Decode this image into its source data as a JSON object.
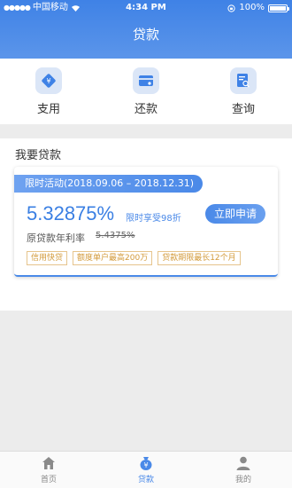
{
  "status": {
    "carrier": "中国移动",
    "time": "4:34 PM",
    "battery": "100%"
  },
  "header": {
    "title": "贷款"
  },
  "quick_actions": [
    {
      "label": "支用",
      "icon": "withdraw-icon"
    },
    {
      "label": "还款",
      "icon": "card-icon"
    },
    {
      "label": "查询",
      "icon": "search-doc-icon"
    }
  ],
  "section": {
    "title": "我要贷款"
  },
  "loan_card": {
    "promo": "限时活动(2018.09.06 – 2018.12.31)",
    "rate": "5.32875%",
    "discount": "限时享受98折",
    "apply_label": "立即申请",
    "orig_rate_label": "原贷款年利率",
    "orig_rate_value": "5.4375%",
    "tags": [
      "信用快贷",
      "额度单户最高200万",
      "贷款期限最长12个月"
    ]
  },
  "tabbar": [
    {
      "label": "首页",
      "icon": "home-icon",
      "active": false
    },
    {
      "label": "贷款",
      "icon": "money-bag-icon",
      "active": true
    },
    {
      "label": "我的",
      "icon": "user-icon",
      "active": false
    }
  ],
  "colors": {
    "brand": "#4a89e8",
    "tag": "#d39a3a"
  }
}
